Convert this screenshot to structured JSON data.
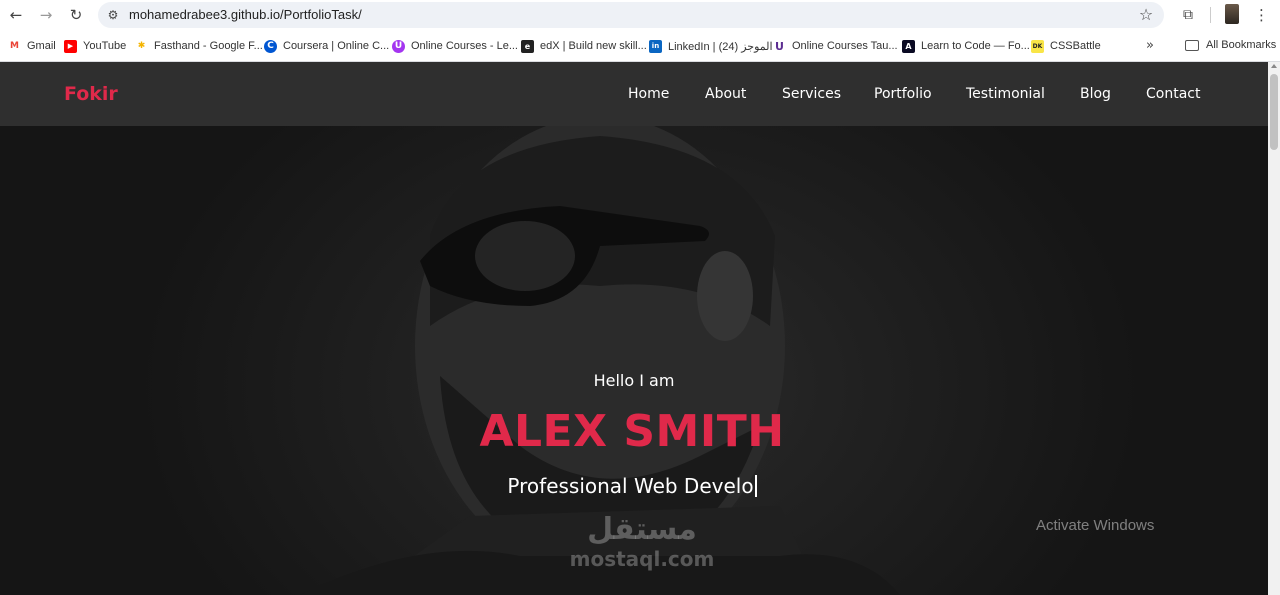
{
  "browser": {
    "url": "mohamedrabee3.github.io/PortfolioTask/",
    "back_icon": "arrow-left-icon",
    "forward_icon": "arrow-right-icon",
    "reload_icon": "reload-icon"
  },
  "bookmarks": {
    "items": [
      {
        "label": "Gmail",
        "color": "#ea4335",
        "glyph": "M"
      },
      {
        "label": "YouTube",
        "color": "#ff0000",
        "glyph": "▶"
      },
      {
        "label": "Fasthand - Google F...",
        "color": "#f4b400",
        "glyph": "✱"
      },
      {
        "label": "Coursera | Online C...",
        "color": "#0056d2",
        "glyph": "C"
      },
      {
        "label": "Online Courses - Le...",
        "color": "#a435f0",
        "glyph": "U"
      },
      {
        "label": "edX | Build new skill...",
        "color": "#222222",
        "glyph": "e"
      },
      {
        "label": "LinkedIn | الموجز (24)",
        "color": "#0a66c2",
        "glyph": "in"
      },
      {
        "label": "Online Courses Tau...",
        "color": "#5c2d91",
        "glyph": "U"
      },
      {
        "label": "Learn to Code — Fo...",
        "color": "#0a0a23",
        "glyph": "A"
      },
      {
        "label": "CSSBattle",
        "color": "#f9e547",
        "glyph": "DK"
      }
    ],
    "more": "»",
    "all_bookmarks": "All Bookmarks"
  },
  "site": {
    "logo": "Fokir",
    "nav": [
      "Home",
      "About",
      "Services",
      "Portfolio",
      "Testimonial",
      "Blog",
      "Contact"
    ],
    "accent": "#e0294a"
  },
  "hero": {
    "greeting": "Hello I am",
    "name": "ALEX SMITH",
    "role": "Professional Web Develo"
  },
  "overlay": {
    "watermark_arabic": "مستقل",
    "watermark_latin": "mostaql.com",
    "activate_windows": "Activate Windows"
  }
}
